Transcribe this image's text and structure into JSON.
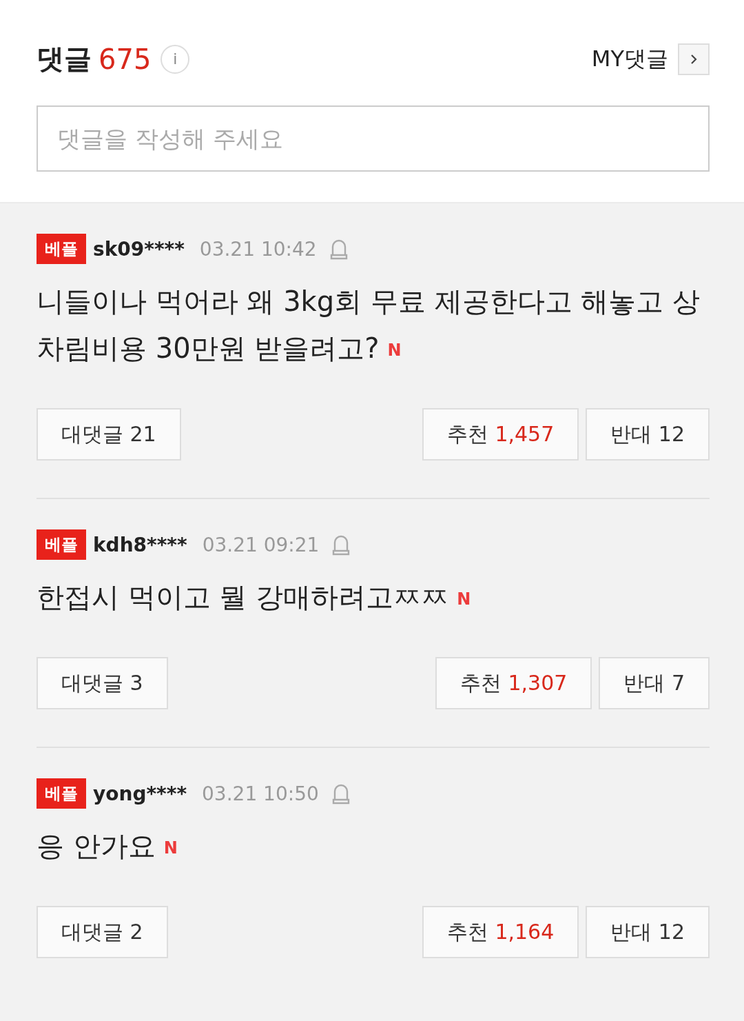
{
  "header": {
    "title": "댓글",
    "count": "675",
    "info_icon": "i",
    "my_comments": "MY댓글"
  },
  "input": {
    "placeholder": "댓글을 작성해 주세요"
  },
  "comments": [
    {
      "badge": "베플",
      "user": "sk09****",
      "time": "03.21 10:42",
      "text": "니들이나 먹어라 왜 3kg회 무료 제공한다고 해놓고 상차림비용 30만원 받을려고?",
      "new_mark": "N",
      "replies_label": "대댓글",
      "replies": "21",
      "like_label": "추천",
      "likes": "1,457",
      "dislike_label": "반대",
      "dislikes": "12"
    },
    {
      "badge": "베플",
      "user": "kdh8****",
      "time": "03.21 09:21",
      "text": "한접시 먹이고 뭘 강매하려고ㅉㅉ",
      "new_mark": "N",
      "replies_label": "대댓글",
      "replies": "3",
      "like_label": "추천",
      "likes": "1,307",
      "dislike_label": "반대",
      "dislikes": "7"
    },
    {
      "badge": "베플",
      "user": "yong****",
      "time": "03.21 10:50",
      "text": "응 안가요",
      "new_mark": "N",
      "replies_label": "대댓글",
      "replies": "2",
      "like_label": "추천",
      "likes": "1,164",
      "dislike_label": "반대",
      "dislikes": "12"
    }
  ]
}
